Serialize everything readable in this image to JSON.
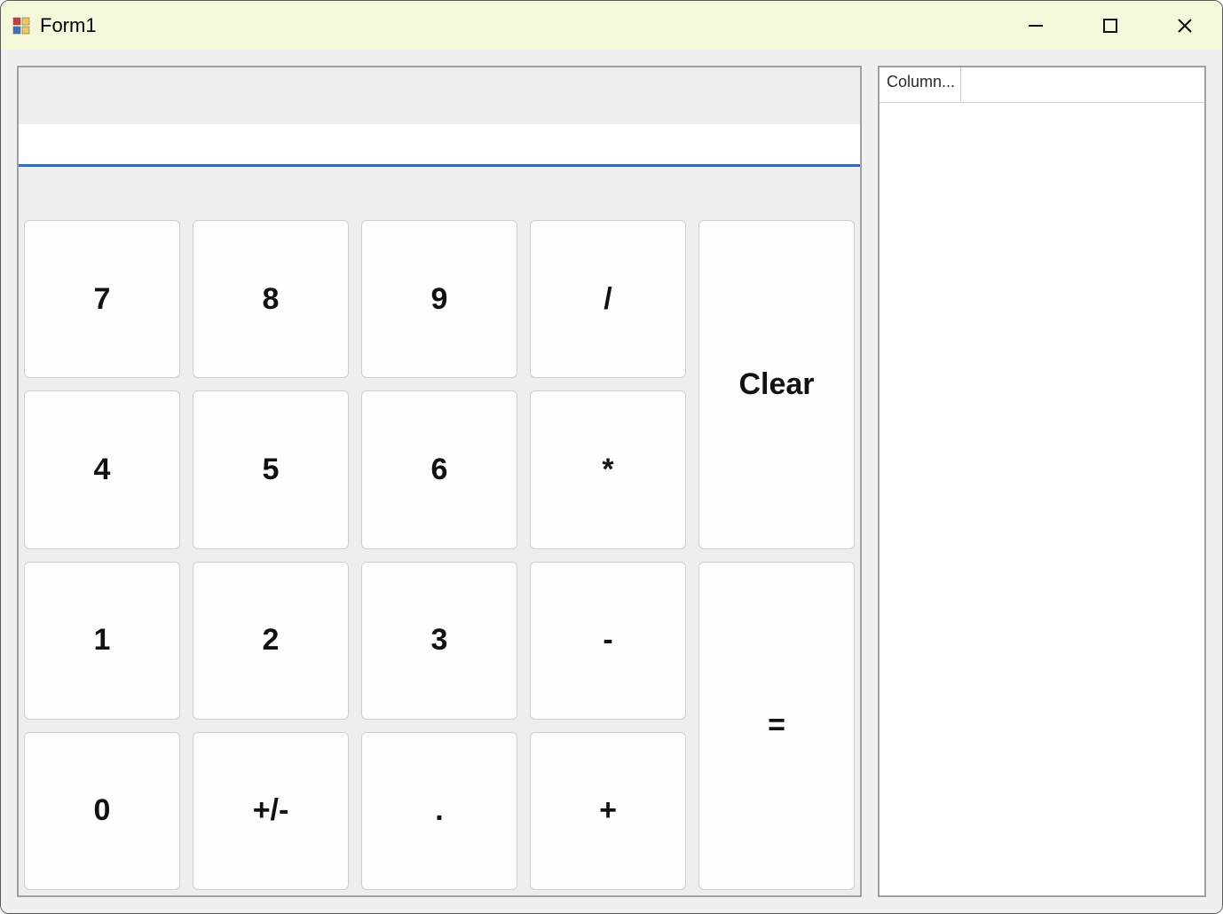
{
  "window": {
    "title": "Form1"
  },
  "display": {
    "value": ""
  },
  "buttons": {
    "r0c0": "7",
    "r0c1": "8",
    "r0c2": "9",
    "r0c3": "/",
    "r1c0": "4",
    "r1c1": "5",
    "r1c2": "6",
    "r1c3": "*",
    "r2c0": "1",
    "r2c1": "2",
    "r2c2": "3",
    "r2c3": "-",
    "r3c0": "0",
    "r3c1": "+/-",
    "r3c2": ".",
    "r3c3": "+",
    "clear": "Clear",
    "equals": "="
  },
  "history": {
    "column_header": "Column..."
  }
}
